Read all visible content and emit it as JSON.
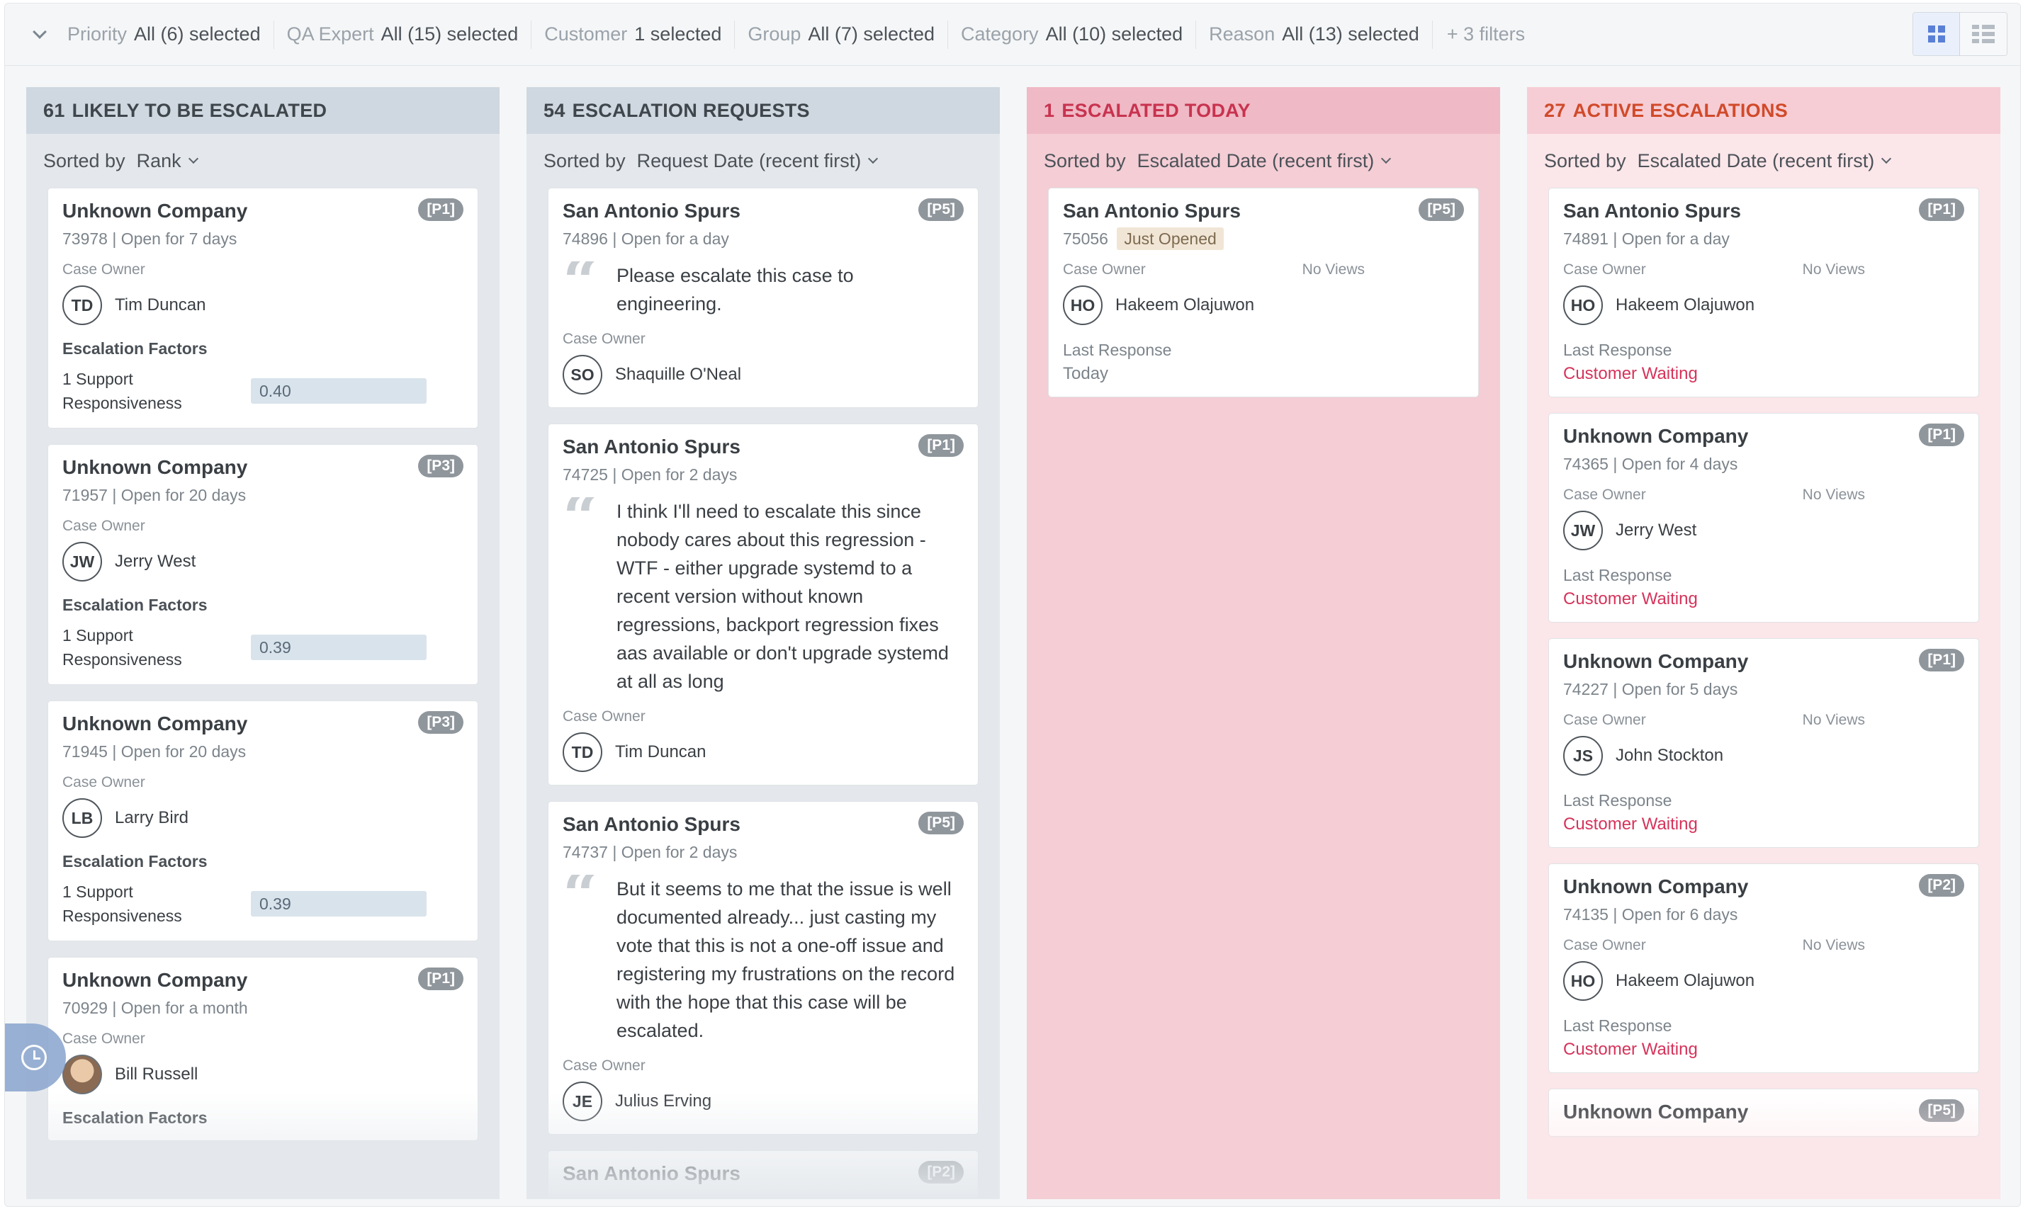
{
  "filters": [
    {
      "label": "Priority",
      "value": "All (6) selected"
    },
    {
      "label": "QA Expert",
      "value": "All (15) selected"
    },
    {
      "label": "Customer",
      "value": "1 selected"
    },
    {
      "label": "Group",
      "value": "All (7) selected"
    },
    {
      "label": "Category",
      "value": "All (10) selected"
    },
    {
      "label": "Reason",
      "value": "All (13) selected"
    }
  ],
  "more_filters": "+ 3 filters",
  "columns": [
    {
      "count": "61",
      "title": "LIKELY TO BE ESCALATED",
      "sort_label": "Sorted by",
      "sort_value": "Rank",
      "cards": [
        {
          "company": "Unknown Company",
          "priority": "[P1]",
          "sub": "73978 | Open for 7 days",
          "owner_label": "Case Owner",
          "initials": "TD",
          "owner": "Tim Duncan",
          "factors_title": "Escalation Factors",
          "factor_label": "1  Support Responsiveness",
          "factor_value": "0.40"
        },
        {
          "company": "Unknown Company",
          "priority": "[P3]",
          "sub": "71957 | Open for 20 days",
          "owner_label": "Case Owner",
          "initials": "JW",
          "owner": "Jerry West",
          "factors_title": "Escalation Factors",
          "factor_label": "1  Support Responsiveness",
          "factor_value": "0.39"
        },
        {
          "company": "Unknown Company",
          "priority": "[P3]",
          "sub": "71945 | Open for 20 days",
          "owner_label": "Case Owner",
          "initials": "LB",
          "owner": "Larry Bird",
          "factors_title": "Escalation Factors",
          "factor_label": "1  Support Responsiveness",
          "factor_value": "0.39"
        },
        {
          "company": "Unknown Company",
          "priority": "[P1]",
          "sub": "70929 | Open for a month",
          "owner_label": "Case Owner",
          "owner": "Bill Russell",
          "factors_title": "Escalation Factors"
        }
      ]
    },
    {
      "count": "54",
      "title": "ESCALATION REQUESTS",
      "sort_label": "Sorted by",
      "sort_value": "Request Date (recent first)",
      "cards": [
        {
          "company": "San Antonio Spurs",
          "priority": "[P5]",
          "sub": "74896 | Open for a day",
          "quote": "Please escalate this case to engineering.",
          "owner_label": "Case Owner",
          "initials": "SO",
          "owner": "Shaquille O'Neal"
        },
        {
          "company": "San Antonio Spurs",
          "priority": "[P1]",
          "sub": "74725 | Open for 2 days",
          "quote": "I think I'll need to escalate this since nobody cares about this regression - WTF - either upgrade systemd to a recent version without known regressions, backport regression fixes aas available or don't upgrade systemd at all as long",
          "owner_label": "Case Owner",
          "initials": "TD",
          "owner": "Tim Duncan"
        },
        {
          "company": "San Antonio Spurs",
          "priority": "[P5]",
          "sub": "74737 | Open for 2 days",
          "quote": "But it seems to me that the issue is well documented already... just casting my vote that this is not a one-off issue and registering my frustrations on the record with the hope that this case will be escalated.",
          "owner_label": "Case Owner",
          "initials": "JE",
          "owner": "Julius Erving"
        },
        {
          "company": "San Antonio Spurs",
          "priority": "[P2]"
        }
      ]
    },
    {
      "count": "1",
      "title": "ESCALATED TODAY",
      "sort_label": "Sorted by",
      "sort_value": "Escalated Date (recent first)",
      "cards": [
        {
          "company": "San Antonio Spurs",
          "priority": "[P5]",
          "sub": "75056",
          "tag": "Just Opened",
          "owner_label": "Case Owner",
          "views": "No Views",
          "initials": "HO",
          "owner": "Hakeem Olajuwon",
          "lr_label": "Last Response",
          "lr_value": "Today"
        }
      ]
    },
    {
      "count": "27",
      "title": "ACTIVE ESCALATIONS",
      "sort_label": "Sorted by",
      "sort_value": "Escalated Date (recent first)",
      "cards": [
        {
          "company": "San Antonio Spurs",
          "priority": "[P1]",
          "sub": "74891 | Open for a day",
          "owner_label": "Case Owner",
          "views": "No Views",
          "initials": "HO",
          "owner": "Hakeem Olajuwon",
          "lr_label": "Last Response",
          "lr_value": "Customer Waiting"
        },
        {
          "company": "Unknown Company",
          "priority": "[P1]",
          "sub": "74365 | Open for 4 days",
          "owner_label": "Case Owner",
          "views": "No Views",
          "initials": "JW",
          "owner": "Jerry West",
          "lr_label": "Last Response",
          "lr_value": "Customer Waiting"
        },
        {
          "company": "Unknown Company",
          "priority": "[P1]",
          "sub": "74227 | Open for 5 days",
          "owner_label": "Case Owner",
          "views": "No Views",
          "initials": "JS",
          "owner": "John Stockton",
          "lr_label": "Last Response",
          "lr_value": "Customer Waiting"
        },
        {
          "company": "Unknown Company",
          "priority": "[P2]",
          "sub": "74135 | Open for 6 days",
          "owner_label": "Case Owner",
          "views": "No Views",
          "initials": "HO",
          "owner": "Hakeem Olajuwon",
          "lr_label": "Last Response",
          "lr_value": "Customer Waiting"
        },
        {
          "company": "Unknown Company",
          "priority": "[P5]"
        }
      ]
    }
  ],
  "colors": {
    "accent": "#5a7fd6",
    "escalated_today_bg": "#f4cdd5",
    "active_bg": "#fbe6e9",
    "customer_waiting": "#d6335a"
  },
  "icons": [
    "chevron-down-icon",
    "grid-view-icon",
    "list-view-icon",
    "quote-icon",
    "clock-icon"
  ]
}
